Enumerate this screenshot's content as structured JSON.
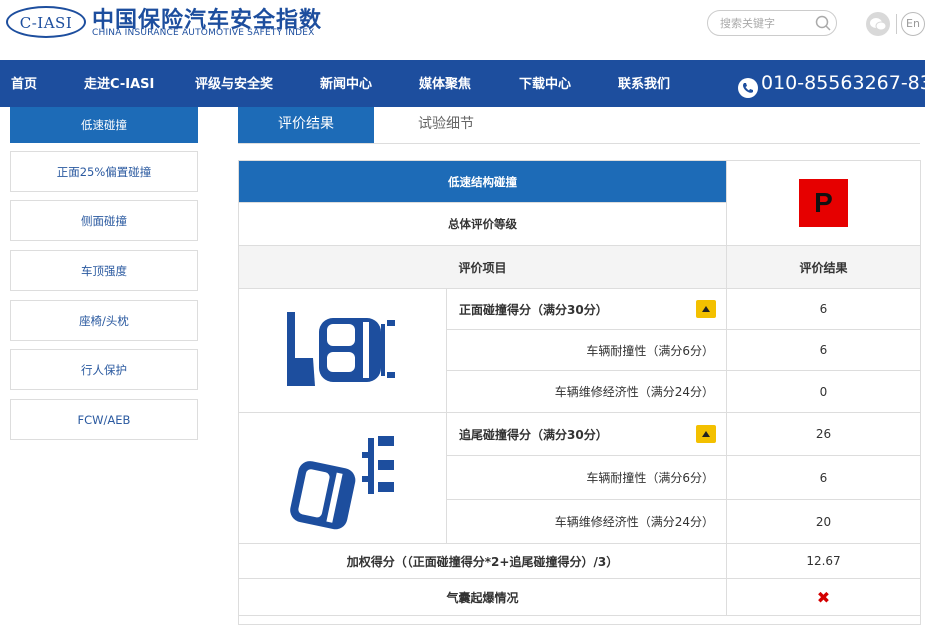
{
  "header": {
    "logo_mark": "C-IASI",
    "title_cn": "中国保险汽车安全指数",
    "title_en": "CHINA INSURANCE AUTOMOTIVE SAFETY INDEX",
    "search_placeholder": "搜索关键字",
    "lang": "En"
  },
  "nav": {
    "items": [
      "首页",
      "走进C-IASI",
      "评级与安全奖",
      "新闻中心",
      "媒体聚焦",
      "下载中心",
      "联系我们"
    ],
    "phone": "010-85563267-83"
  },
  "sidebar": {
    "items": [
      "低速碰撞",
      "正面25%偏置碰撞",
      "侧面碰撞",
      "车顶强度",
      "座椅/头枕",
      "行人保护",
      "FCW/AEB"
    ],
    "active_index": 0
  },
  "tabs": {
    "active": "评价结果",
    "other": "试验细节"
  },
  "table": {
    "title": "低速结构碰撞",
    "overall_label": "总体评价等级",
    "overall_grade": "P",
    "overall_grade_color": "#e60000",
    "col_item": "评价项目",
    "col_result": "评价结果",
    "front": {
      "total_label": "正面碰撞得分（满分30分）",
      "total_value": "6",
      "rows": [
        {
          "label": "车辆耐撞性（满分6分）",
          "value": "6"
        },
        {
          "label": "车辆维修经济性（满分24分）",
          "value": "0"
        }
      ]
    },
    "rear": {
      "total_label": "追尾碰撞得分（满分30分）",
      "total_value": "26",
      "rows": [
        {
          "label": "车辆耐撞性（满分6分）",
          "value": "6"
        },
        {
          "label": "车辆维修经济性（满分24分）",
          "value": "20"
        }
      ]
    },
    "weighted_label": "加权得分（（正面碰撞得分*2+追尾碰撞得分）/3）",
    "weighted_value": "12.67",
    "airbag_label": "气囊起爆情况",
    "airbag_value": "✖"
  },
  "colors": {
    "brand_blue": "#1d4e9e",
    "accent_blue": "#1d6bb7",
    "toggle_yellow": "#f3c000",
    "cross_red": "#d40000"
  }
}
